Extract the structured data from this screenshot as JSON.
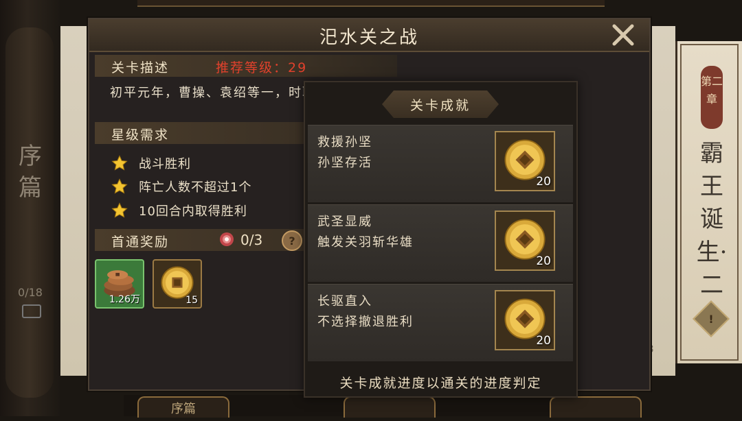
{
  "background": {
    "left_chapter_title": "序篇",
    "left_chapter_progress": "0/18",
    "right_chapter_badge": "第二章",
    "right_chapter_title": "霸王诞生·二",
    "right_side_number": "8",
    "bottom_tabs": [
      "序篇",
      "",
      ""
    ]
  },
  "dialog": {
    "title": "汜水关之战",
    "description": {
      "label": "关卡描述",
      "recommended_level": "推荐等级：29",
      "text": "初平元年，曹操、袁绍等一，时联军进兵汜水关下，对阵…临"
    },
    "star_requirements": {
      "label": "星级需求",
      "items": [
        "战斗胜利",
        "阵亡人数不超过1个",
        "10回合内取得胜利"
      ]
    },
    "first_clear_reward": {
      "label": "首通奖励",
      "progress": "0/3",
      "help": "?",
      "rewards": [
        {
          "icon": "copper-coins-icon",
          "quantity": "1.26万"
        },
        {
          "icon": "gold-coin-icon",
          "quantity": "15"
        }
      ]
    }
  },
  "achievements": {
    "title": "关卡成就",
    "items": [
      {
        "name": "救援孙坚",
        "desc": "孙坚存活",
        "reward_quantity": "20"
      },
      {
        "name": "武圣显威",
        "desc": "触发关羽斩华雄",
        "reward_quantity": "20"
      },
      {
        "name": "长驱直入",
        "desc": "不选择撤退胜利",
        "reward_quantity": "20"
      }
    ],
    "footer": "关卡成就进度以通关的进度判定"
  },
  "colors": {
    "recommend_red": "#e0412c",
    "gold": "#d9a93a",
    "panel_dark": "#262120"
  }
}
